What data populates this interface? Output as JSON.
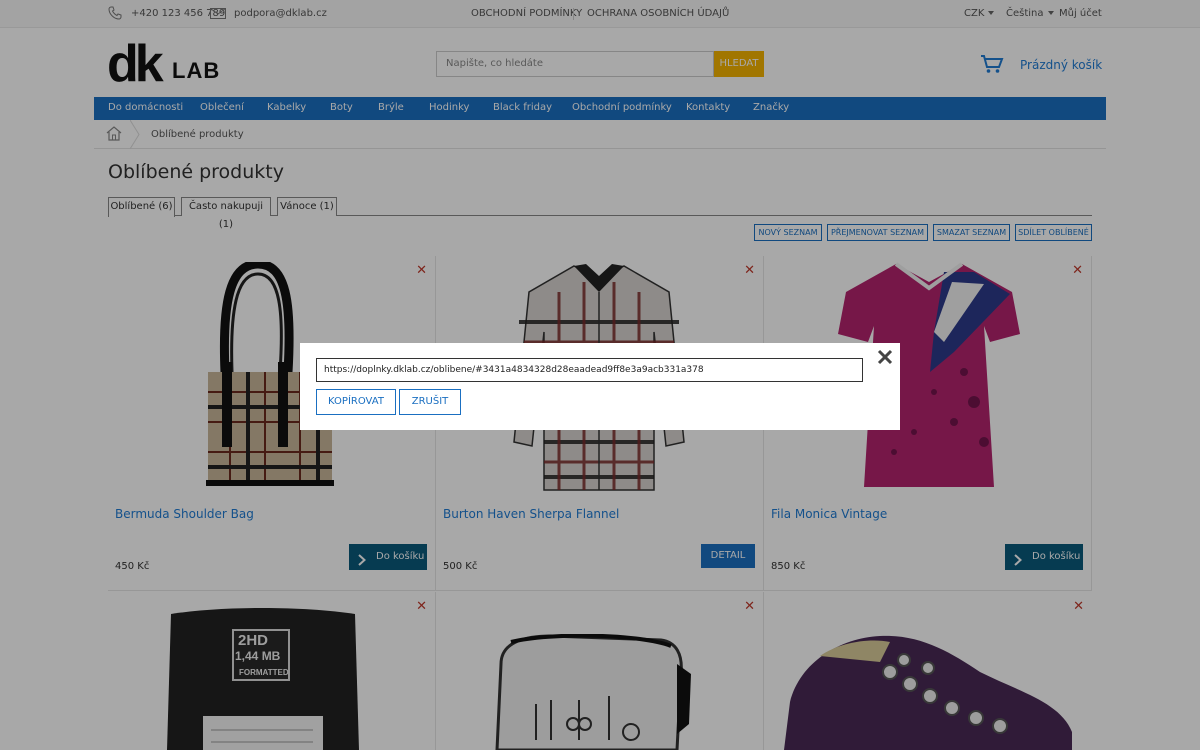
{
  "topbar": {
    "phone": "+420 123 456 789",
    "email": "podpora@dklab.cz",
    "links": [
      "OBCHODNÍ PODMÍNKY",
      "OCHRANA OSOBNÍCH ÚDAJŮ"
    ],
    "currency": "CZK",
    "language": "Čeština",
    "account": "Můj účet"
  },
  "header": {
    "logo_dk": "dk",
    "logo_lab": "LAB",
    "search_placeholder": "Napište, co hledáte",
    "search_button": "HLEDAT",
    "cart_label": "Prázdný košík"
  },
  "nav": {
    "items": [
      "Do domácnosti",
      "Oblečení",
      "Kabelky",
      "Boty",
      "Brýle",
      "Hodinky",
      "Black friday",
      "Obchodní podmínky",
      "Kontakty",
      "Značky"
    ]
  },
  "breadcrumb": {
    "current": "Oblíbené produkty"
  },
  "page": {
    "title": "Oblíbené produkty",
    "tabs": [
      "Oblíbené (6)",
      "Často nakupuji (1)",
      "Vánoce (1)"
    ],
    "active_tab": 0,
    "actions": [
      "NOVÝ SEZNAM",
      "PŘEJMENOVAT SEZNAM",
      "SMAZAT SEZNAM",
      "SDÍLET OBLÍBENÉ"
    ]
  },
  "products": [
    {
      "name": "Bermuda Shoulder Bag",
      "price": "450 Kč",
      "button": "Do košíku",
      "button_type": "cart"
    },
    {
      "name": "Burton Haven Sherpa Flannel",
      "price": "500 Kč",
      "button": "DETAIL",
      "button_type": "detail"
    },
    {
      "name": "Fila Monica Vintage",
      "price": "850 Kč",
      "button": "Do košíku",
      "button_type": "cart"
    }
  ],
  "products_row2": [
    "floppy-pillow",
    "gentleman-toiletry-bag",
    "purple-sneaker"
  ],
  "floppy": {
    "line1": "2HD",
    "line2": "1,44 MB",
    "line3": "FORMATTED"
  },
  "modal": {
    "url": "https://doplnky.dklab.cz/oblibene/#3431a4834328d28eaadead9ff8e3a9acb331a378",
    "copy_label": "KOPÍROVAT",
    "cancel_label": "ZRUŠIT"
  },
  "colors": {
    "accent": "#1a6fc1",
    "nav_bg": "#1a6fc1",
    "search_button": "#f4b400",
    "cart_button": "#0a5a7c",
    "remove_x": "#c0392b",
    "overlay": "rgba(0,0,0,0.34)"
  }
}
